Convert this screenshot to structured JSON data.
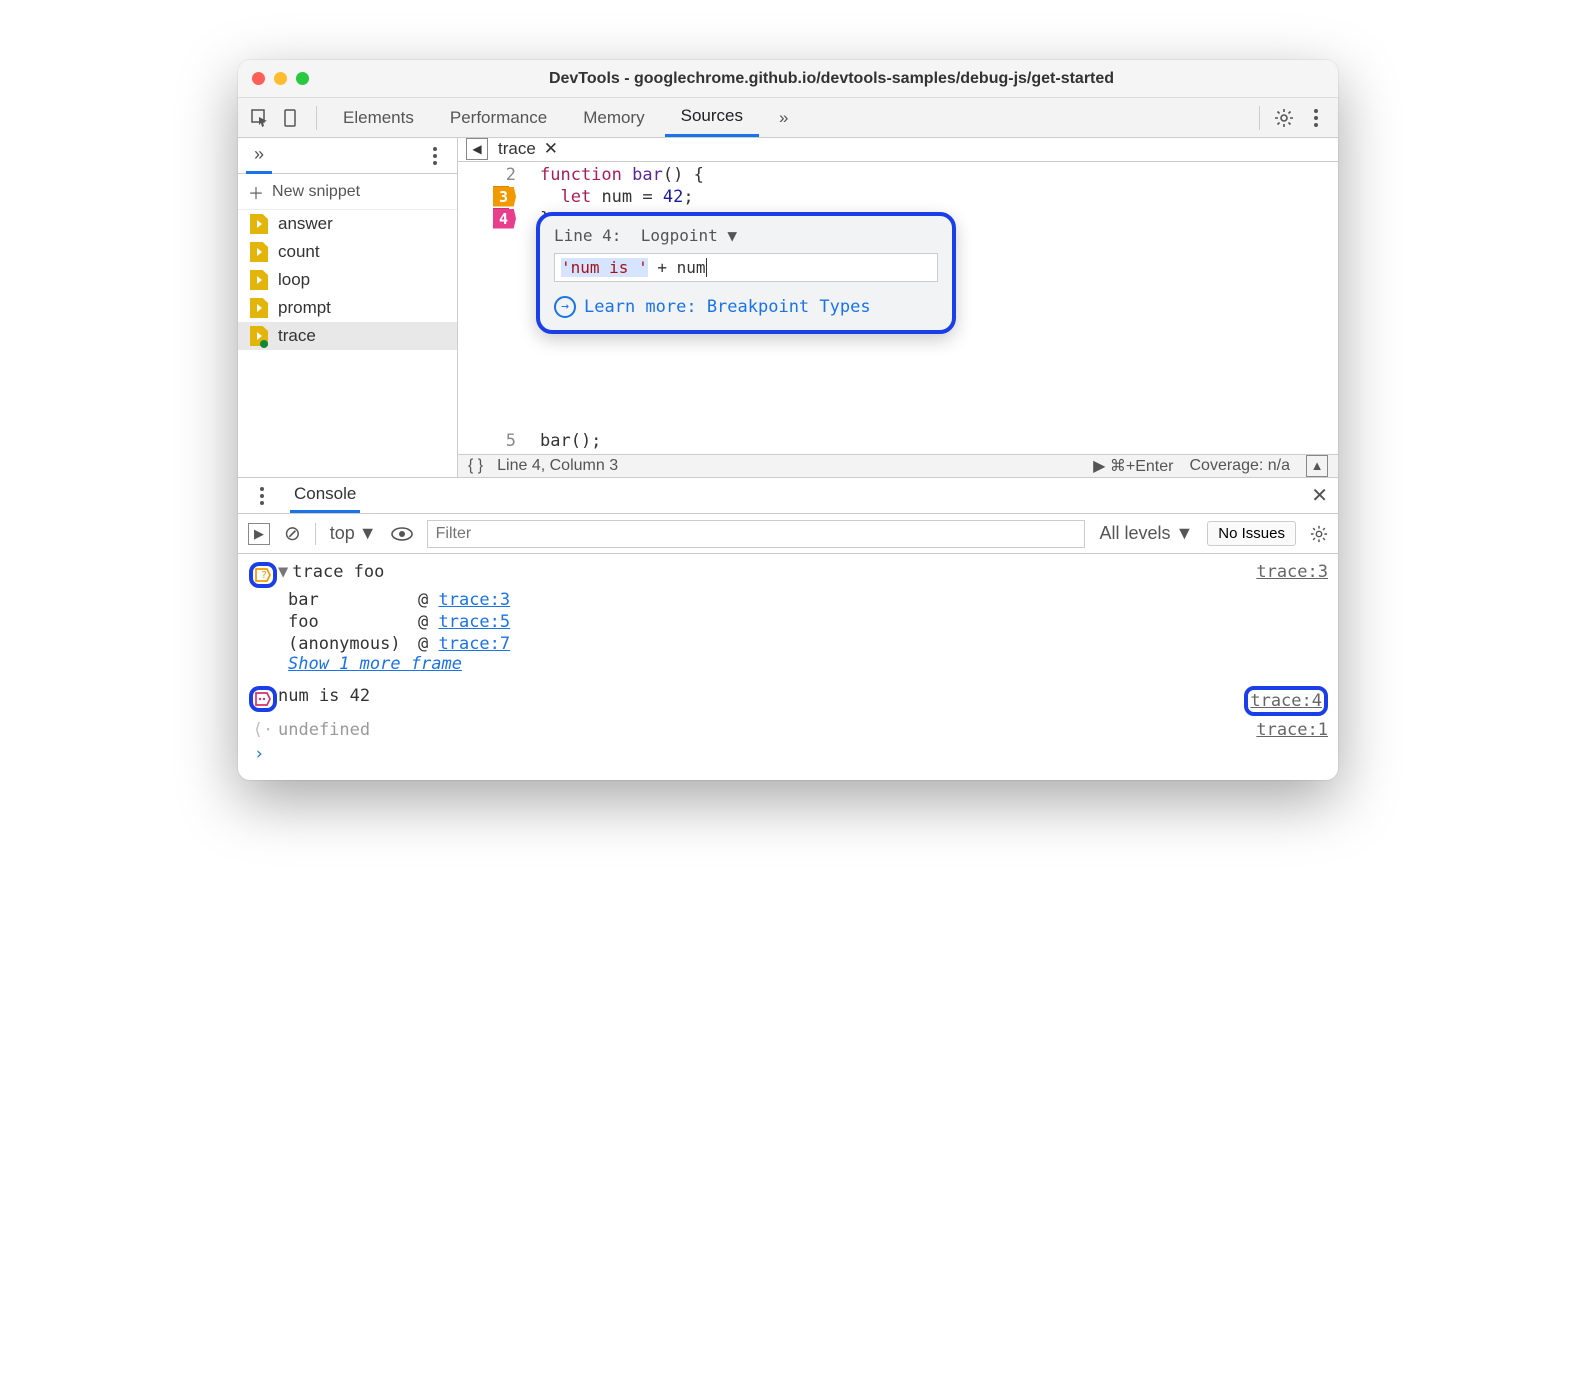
{
  "window_title": "DevTools - googlechrome.github.io/devtools-samples/debug-js/get-started",
  "tabs": {
    "elements": "Elements",
    "performance": "Performance",
    "memory": "Memory",
    "sources": "Sources",
    "more": "»"
  },
  "sidebar": {
    "more": "»",
    "new_snippet": "New snippet",
    "items": [
      {
        "label": "answer"
      },
      {
        "label": "count"
      },
      {
        "label": "loop"
      },
      {
        "label": "prompt"
      },
      {
        "label": "trace"
      }
    ]
  },
  "editor": {
    "tab_name": "trace",
    "lines": {
      "l2_num": "2",
      "l3_num": "3",
      "l4_num": "4",
      "l5_num": "5",
      "l2": "function bar() {",
      "l3": "  let num = 42;",
      "l4": "}",
      "l5": "bar();"
    },
    "bp3_sym": "?",
    "bp4_sym": "••",
    "popup": {
      "line_label": "Line 4:",
      "type": "Logpoint",
      "expr_str": "'num is '",
      "expr_rest": " + num",
      "learn": "Learn more: Breakpoint Types"
    },
    "status": {
      "pos": "Line 4, Column 3",
      "run": "⌘+Enter",
      "coverage": "Coverage: n/a"
    }
  },
  "console": {
    "tab": "Console",
    "toolbar": {
      "context": "top",
      "filter_ph": "Filter",
      "levels": "All levels",
      "issues": "No Issues"
    },
    "log1": {
      "text": "trace foo",
      "src": "trace:3",
      "frames": [
        {
          "fn": "bar",
          "loc": "trace:3"
        },
        {
          "fn": "foo",
          "loc": "trace:5"
        },
        {
          "fn": "(anonymous)",
          "loc": "trace:7"
        }
      ],
      "more": "Show 1 more frame"
    },
    "log2": {
      "text": "num is 42",
      "src": "trace:4"
    },
    "log3": {
      "text": "undefined",
      "src": "trace:1"
    }
  }
}
